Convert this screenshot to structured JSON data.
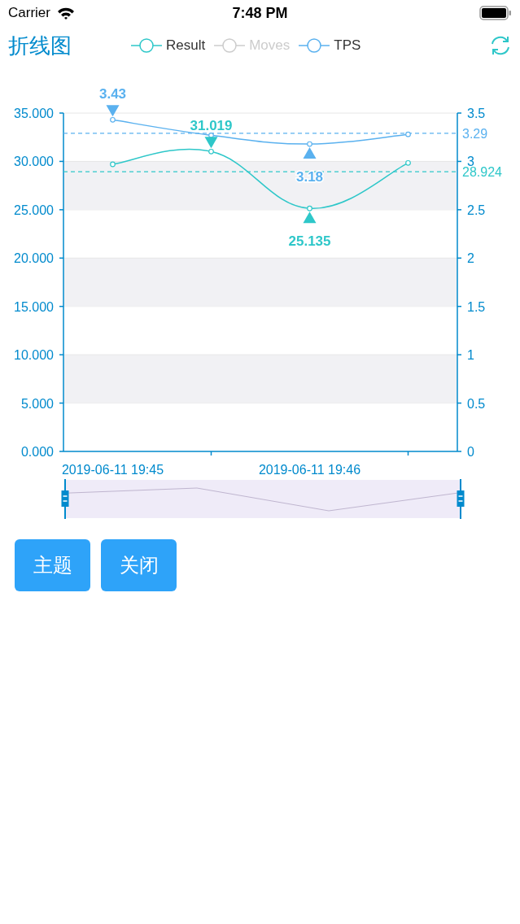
{
  "status_bar": {
    "carrier": "Carrier",
    "time": "7:48 PM"
  },
  "header": {
    "title": "折线图",
    "legend": [
      {
        "kind": "series",
        "selected": true
      },
      {
        "kind": "hidden",
        "label": "Moves",
        "selected": false
      },
      {
        "kind": "series",
        "selected": true
      }
    ]
  },
  "chart": {
    "chart_data": {
      "type": "line",
      "legend": "top",
      "grid": true,
      "categories": [
        "2019-06-11 19:45",
        null,
        "2019-06-11 19:46",
        null
      ],
      "ylim": [
        0,
        35
      ],
      "yticks": [
        {
          "value": 0,
          "label": "0.000"
        },
        {
          "value": 5,
          "label": "5.000"
        },
        {
          "value": 10,
          "label": "10.000"
        },
        {
          "value": 15,
          "label": "15.000"
        },
        {
          "value": 20,
          "label": "20.000"
        },
        {
          "value": 25,
          "label": "25.000"
        },
        {
          "value": 30,
          "label": "30.000"
        },
        {
          "value": 35,
          "label": "35.000"
        }
      ],
      "y2lim": [
        0,
        3.5
      ],
      "y2ticks": [
        {
          "value": 0,
          "label": "0"
        },
        {
          "value": 0.5,
          "label": "0.5"
        },
        {
          "value": 1,
          "label": "1"
        },
        {
          "value": 1.5,
          "label": "1.5"
        },
        {
          "value": 2,
          "label": "2"
        },
        {
          "value": 2.5,
          "label": "2.5"
        },
        {
          "value": 3,
          "label": "3"
        },
        {
          "value": 3.5,
          "label": "3.5"
        }
      ],
      "series": [
        {
          "name": "Result",
          "color": "#2ec7c9",
          "marker": "circle",
          "values": [
            29.7,
            31.019,
            25.135,
            29.842
          ]
        },
        {
          "name": "TPS",
          "color": "#5ab1ef",
          "axis": "y2",
          "marker": "circle",
          "values": [
            3.43,
            3.27,
            3.18,
            3.28
          ]
        }
      ],
      "annotations": [
        "3.43",
        "31.019",
        "3.18",
        "25.135"
      ],
      "ref_lines": [
        {
          "axis": "y2",
          "value": 3.29,
          "label": "3.29",
          "color": "#5ab1ef"
        },
        {
          "axis": "y",
          "value": 28.924,
          "label": "28.924",
          "color": "#2ec7c9"
        }
      ]
    }
  },
  "buttons": [
    "主题",
    "关闭"
  ]
}
